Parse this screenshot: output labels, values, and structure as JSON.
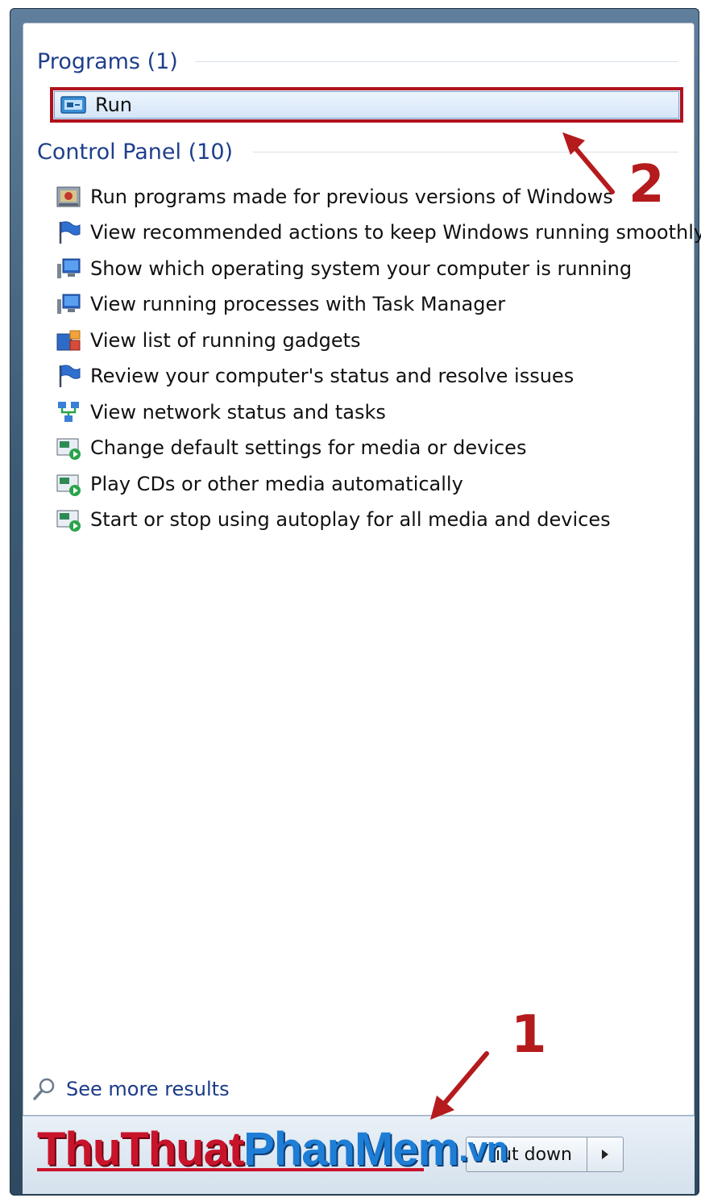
{
  "programs_header": "Programs (1)",
  "control_panel_header": "Control Panel (10)",
  "run_item": {
    "label": "Run",
    "icon": "run-icon"
  },
  "control_panel_items": [
    {
      "label": "Run programs made for previous versions of Windows",
      "icon": "compat-icon"
    },
    {
      "label": "View recommended actions to keep Windows running smoothly",
      "icon": "flag-icon"
    },
    {
      "label": "Show which operating system your computer is running",
      "icon": "system-icon"
    },
    {
      "label": "View running processes with Task Manager",
      "icon": "system-icon"
    },
    {
      "label": "View list of running gadgets",
      "icon": "gadgets-icon"
    },
    {
      "label": "Review your computer's status and resolve issues",
      "icon": "flag-icon"
    },
    {
      "label": "View network status and tasks",
      "icon": "network-icon"
    },
    {
      "label": "Change default settings for media or devices",
      "icon": "autoplay-icon"
    },
    {
      "label": "Play CDs or other media automatically",
      "icon": "autoplay-icon"
    },
    {
      "label": "Start or stop using autoplay for all media and devices",
      "icon": "autoplay-icon"
    }
  ],
  "see_more": "See more results",
  "shutdown_label": "ıut down",
  "annotations": {
    "one": "1",
    "two": "2"
  },
  "watermark": {
    "part1": "ThuThuat",
    "part2": "PhanMem",
    "part3": ".vn"
  },
  "colors": {
    "accent": "#1e3f8b",
    "annotation_red": "#b51a1d",
    "watermark_red": "#c8142b",
    "watermark_blue": "#1e7ed6"
  }
}
